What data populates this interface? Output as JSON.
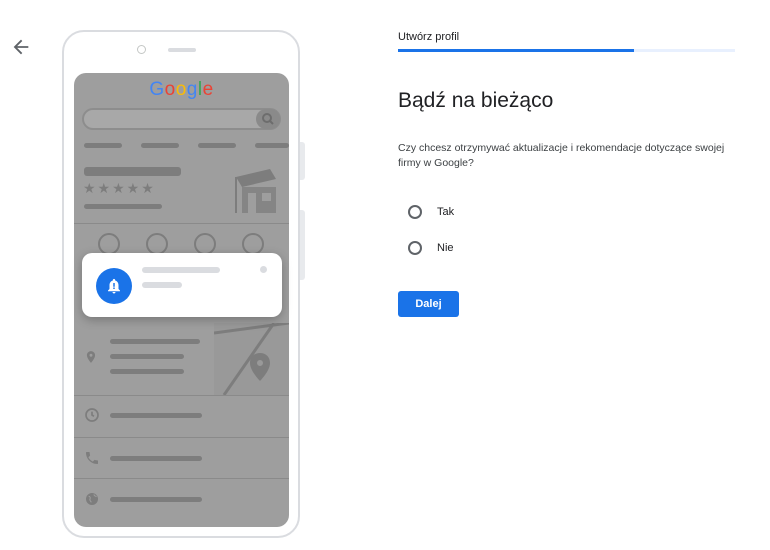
{
  "nav": {
    "back_icon": "arrow-back-icon"
  },
  "illustration": {
    "logo_text": "Google",
    "logo_colors": [
      "#4285f4",
      "#ea4335",
      "#fbbc05",
      "#4285f4",
      "#34a853",
      "#ea4335"
    ],
    "notification_icon": "bell-alert-icon"
  },
  "header": {
    "step_label": "Utwórz profil",
    "progress": 0.7
  },
  "main": {
    "title": "Bądź na bieżąco",
    "question": "Czy chcesz otrzymywać aktualizacje i rekomendacje dotyczące swojej firmy w Google?",
    "options": [
      {
        "label": "Tak",
        "selected": false
      },
      {
        "label": "Nie",
        "selected": false
      }
    ],
    "next_label": "Dalej"
  },
  "colors": {
    "accent": "#1a73e8",
    "progress_track": "#e8f0fe"
  }
}
